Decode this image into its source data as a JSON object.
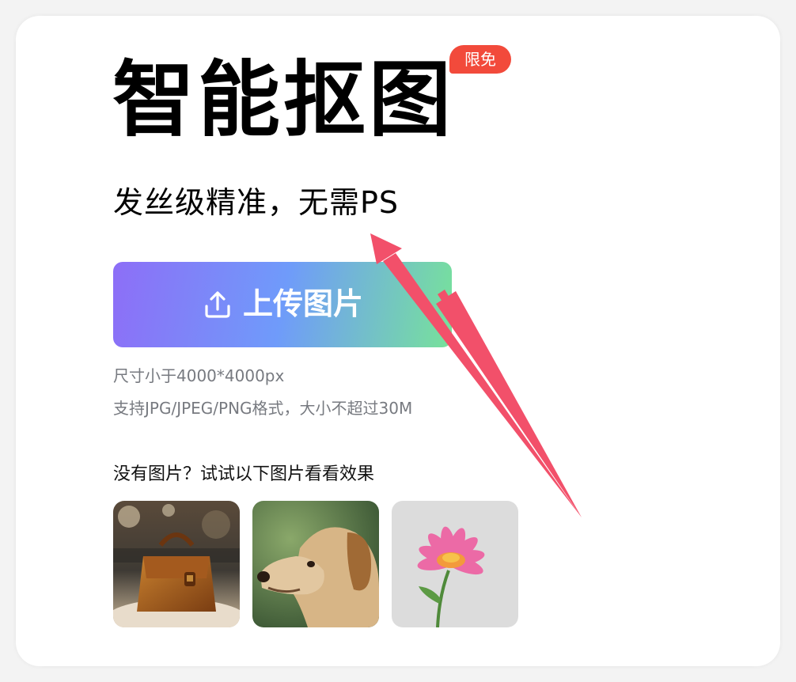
{
  "hero": {
    "title": "智能抠图",
    "badge": "限免",
    "subtitle": "发丝级精准，无需PS"
  },
  "upload": {
    "label": "上传图片",
    "icon": "upload-icon"
  },
  "hints": {
    "size": "尺寸小于4000*4000px",
    "format": "支持JPG/JPEG/PNG格式，大小不超过30M"
  },
  "samples": {
    "title": "没有图片？试试以下图片看看效果",
    "items": [
      "handbag",
      "dog",
      "flower"
    ]
  },
  "colors": {
    "badge": "#f24a3b",
    "gradient_start": "#8d6ef7",
    "gradient_mid": "#6f9bfa",
    "gradient_end": "#77e29a",
    "annotation_arrow": "#f2506a"
  }
}
